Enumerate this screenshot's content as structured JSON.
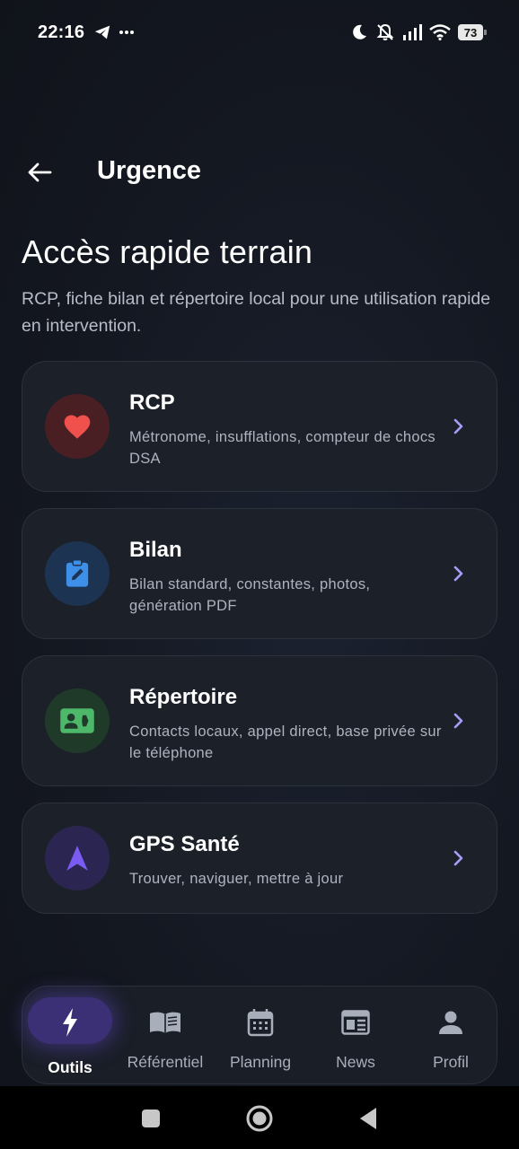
{
  "status_bar": {
    "time": "22:16",
    "notifications": [
      "telegram-icon",
      "more-dots-icon"
    ],
    "indicators": [
      "moon-icon",
      "mute-icon",
      "signal-icon",
      "wifi-icon"
    ],
    "battery": "73"
  },
  "app_bar": {
    "title": "Urgence",
    "back_icon": "arrow-left-icon"
  },
  "page": {
    "heading": "Accès rapide terrain",
    "description": "RCP, fiche bilan et répertoire local pour une utilisation rapide en intervention."
  },
  "cards": [
    {
      "title": "RCP",
      "subtitle": "Métronome, insufflations, compteur de chocs DSA",
      "icon": "heart-icon",
      "icon_color": "#f0514c",
      "icon_bg": "#4a1f24"
    },
    {
      "title": "Bilan",
      "subtitle": "Bilan standard, constantes, photos, génération PDF",
      "icon": "clipboard-edit-icon",
      "icon_color": "#3d8fe8",
      "icon_bg": "#1c3452"
    },
    {
      "title": "Répertoire",
      "subtitle": "Contacts locaux, appel direct, base privée sur le téléphone",
      "icon": "contact-card-icon",
      "icon_color": "#4db86a",
      "icon_bg": "#1f3a29"
    },
    {
      "title": "GPS Santé",
      "subtitle": "Trouver, naviguer, mettre à jour",
      "icon": "navigation-arrow-icon",
      "icon_color": "#7b5cf2",
      "icon_bg": "#2b2651"
    }
  ],
  "chevron_color": "#a99cf5",
  "bottom_nav": {
    "active_index": 0,
    "items": [
      {
        "label": "Outils",
        "icon": "bolt-icon"
      },
      {
        "label": "Référentiel",
        "icon": "book-icon"
      },
      {
        "label": "Planning",
        "icon": "calendar-icon"
      },
      {
        "label": "News",
        "icon": "newspaper-icon"
      },
      {
        "label": "Profil",
        "icon": "person-icon"
      }
    ]
  },
  "system_nav": [
    "recents-square-icon",
    "home-circle-icon",
    "back-triangle-icon"
  ]
}
